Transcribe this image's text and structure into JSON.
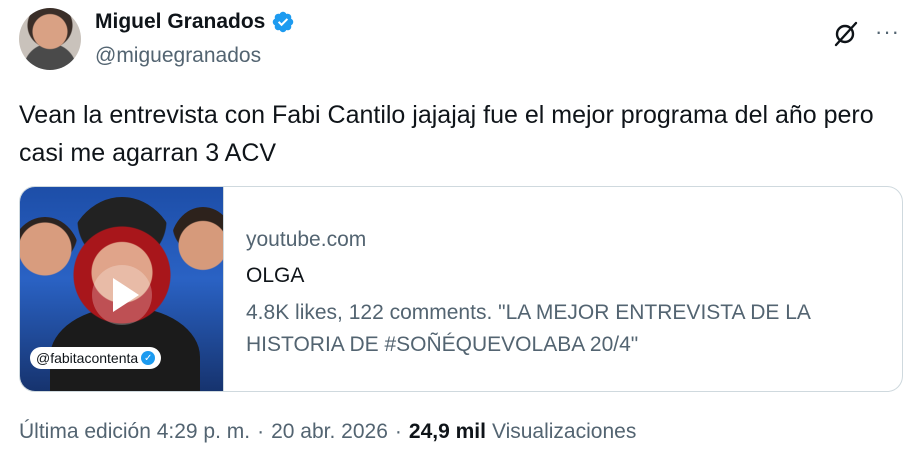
{
  "author": {
    "display_name": "Miguel Granados",
    "handle": "@miguegranados",
    "verified": true,
    "verified_color": "#1d9bf0"
  },
  "tweet": {
    "text": "Vean la entrevista con Fabi Cantilo jajajaj fue el mejor programa del año pero casi me agarran 3 ACV"
  },
  "card": {
    "domain": "youtube.com",
    "title": "OLGA",
    "description": "4.8K likes, 122 comments. \"LA MEJOR ENTREVISTA DE LA HISTORIA DE #SOÑÉQUEVOLABA 20/4\"",
    "thumbnail_tag": "@fabitacontenta"
  },
  "meta": {
    "edited_time": "Última edición 4:29 p. m.",
    "separator": "·",
    "date": "20 abr. 2026",
    "views_count": "24,9 mil",
    "views_label": "Visualizaciones"
  },
  "icons": {
    "grok": "grok-icon",
    "more": "more-icon",
    "verified": "verified-badge-icon",
    "play": "play-icon"
  }
}
